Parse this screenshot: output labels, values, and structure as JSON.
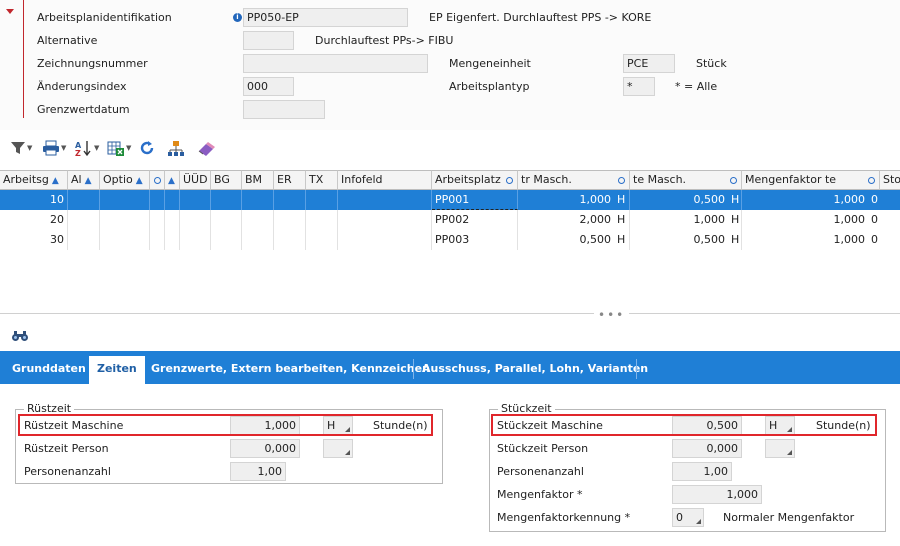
{
  "header": {
    "arbeitsplan_label": "Arbeitsplanidentifikation",
    "arbeitsplan_value": "PP050-EP",
    "arbeitsplan_desc": "EP Eigenfert. Durchlauftest PPS -> KORE",
    "alternative_label": "Alternative",
    "alternative_value": "",
    "alternative_desc": "Durchlauftest PPs-> FIBU",
    "zeichnung_label": "Zeichnungsnummer",
    "zeichnung_value": "",
    "aenderung_label": "Änderungsindex",
    "aenderung_value": "000",
    "grenzwert_label": "Grenzwertdatum",
    "grenzwert_value": "",
    "mengeneinheit_label": "Mengeneinheit",
    "mengeneinheit_value": "PCE",
    "mengeneinheit_desc": "Stück",
    "arbeitsplantyp_label": "Arbeitsplantyp",
    "arbeitsplantyp_value": "*",
    "arbeitsplantyp_desc": "* = Alle"
  },
  "toolbar": {
    "icons": [
      "filter-icon",
      "print-icon",
      "sort-az-icon",
      "export-excel-icon",
      "refresh-icon",
      "hierarchy-icon",
      "eraser-icon"
    ]
  },
  "table": {
    "columns": [
      "Arbeitsg",
      "Al",
      "Optio",
      "",
      "ÜÜD",
      "BG",
      "BM",
      "ER",
      "TX",
      "Infofeld",
      "Arbeitsplatz",
      "tr Masch.",
      "te Masch.",
      "Mengenfaktor te",
      "Sto"
    ],
    "rows": [
      {
        "ag": "10",
        "platz": "PP001",
        "tr": "1,000",
        "tr_unit": "H",
        "te": "0,500",
        "te_unit": "H",
        "mf": "1,000",
        "sto": "0"
      },
      {
        "ag": "20",
        "platz": "PP002",
        "tr": "2,000",
        "tr_unit": "H",
        "te": "1,000",
        "te_unit": "H",
        "mf": "1,000",
        "sto": "0"
      },
      {
        "ag": "30",
        "platz": "PP003",
        "tr": "0,500",
        "tr_unit": "H",
        "te": "0,500",
        "te_unit": "H",
        "mf": "1,000",
        "sto": "0"
      }
    ],
    "selected_row": 0
  },
  "tabs": [
    "Grunddaten",
    "Zeiten",
    "Grenzwerte, Extern bearbeiten, Kennzeichen",
    "Ausschuss, Parallel, Lohn, Varianten"
  ],
  "active_tab": 1,
  "ruestzeit": {
    "title": "Rüstzeit",
    "maschine_label": "Rüstzeit Maschine",
    "maschine_value": "1,000",
    "maschine_unit": "H",
    "maschine_unit_desc": "Stunde(n)",
    "person_label": "Rüstzeit Person",
    "person_value": "0,000",
    "person_unit": "",
    "personen_label": "Personenanzahl",
    "personen_value": "1,00"
  },
  "stueckzeit": {
    "title": "Stückzeit",
    "maschine_label": "Stückzeit Maschine",
    "maschine_value": "0,500",
    "maschine_unit": "H",
    "maschine_unit_desc": "Stunde(n)",
    "person_label": "Stückzeit Person",
    "person_value": "0,000",
    "person_unit": "",
    "personen_label": "Personenanzahl",
    "personen_value": "1,00",
    "mengenfaktor_label": "Mengenfaktor *",
    "mengenfaktor_value": "1,000",
    "kennung_label": "Mengenfaktorkennung *",
    "kennung_value": "0",
    "kennung_desc": "Normaler Mengenfaktor"
  },
  "colors": {
    "accent": "#1f7fd6",
    "highlight": "#e0262b",
    "marker": "#c1272d"
  }
}
